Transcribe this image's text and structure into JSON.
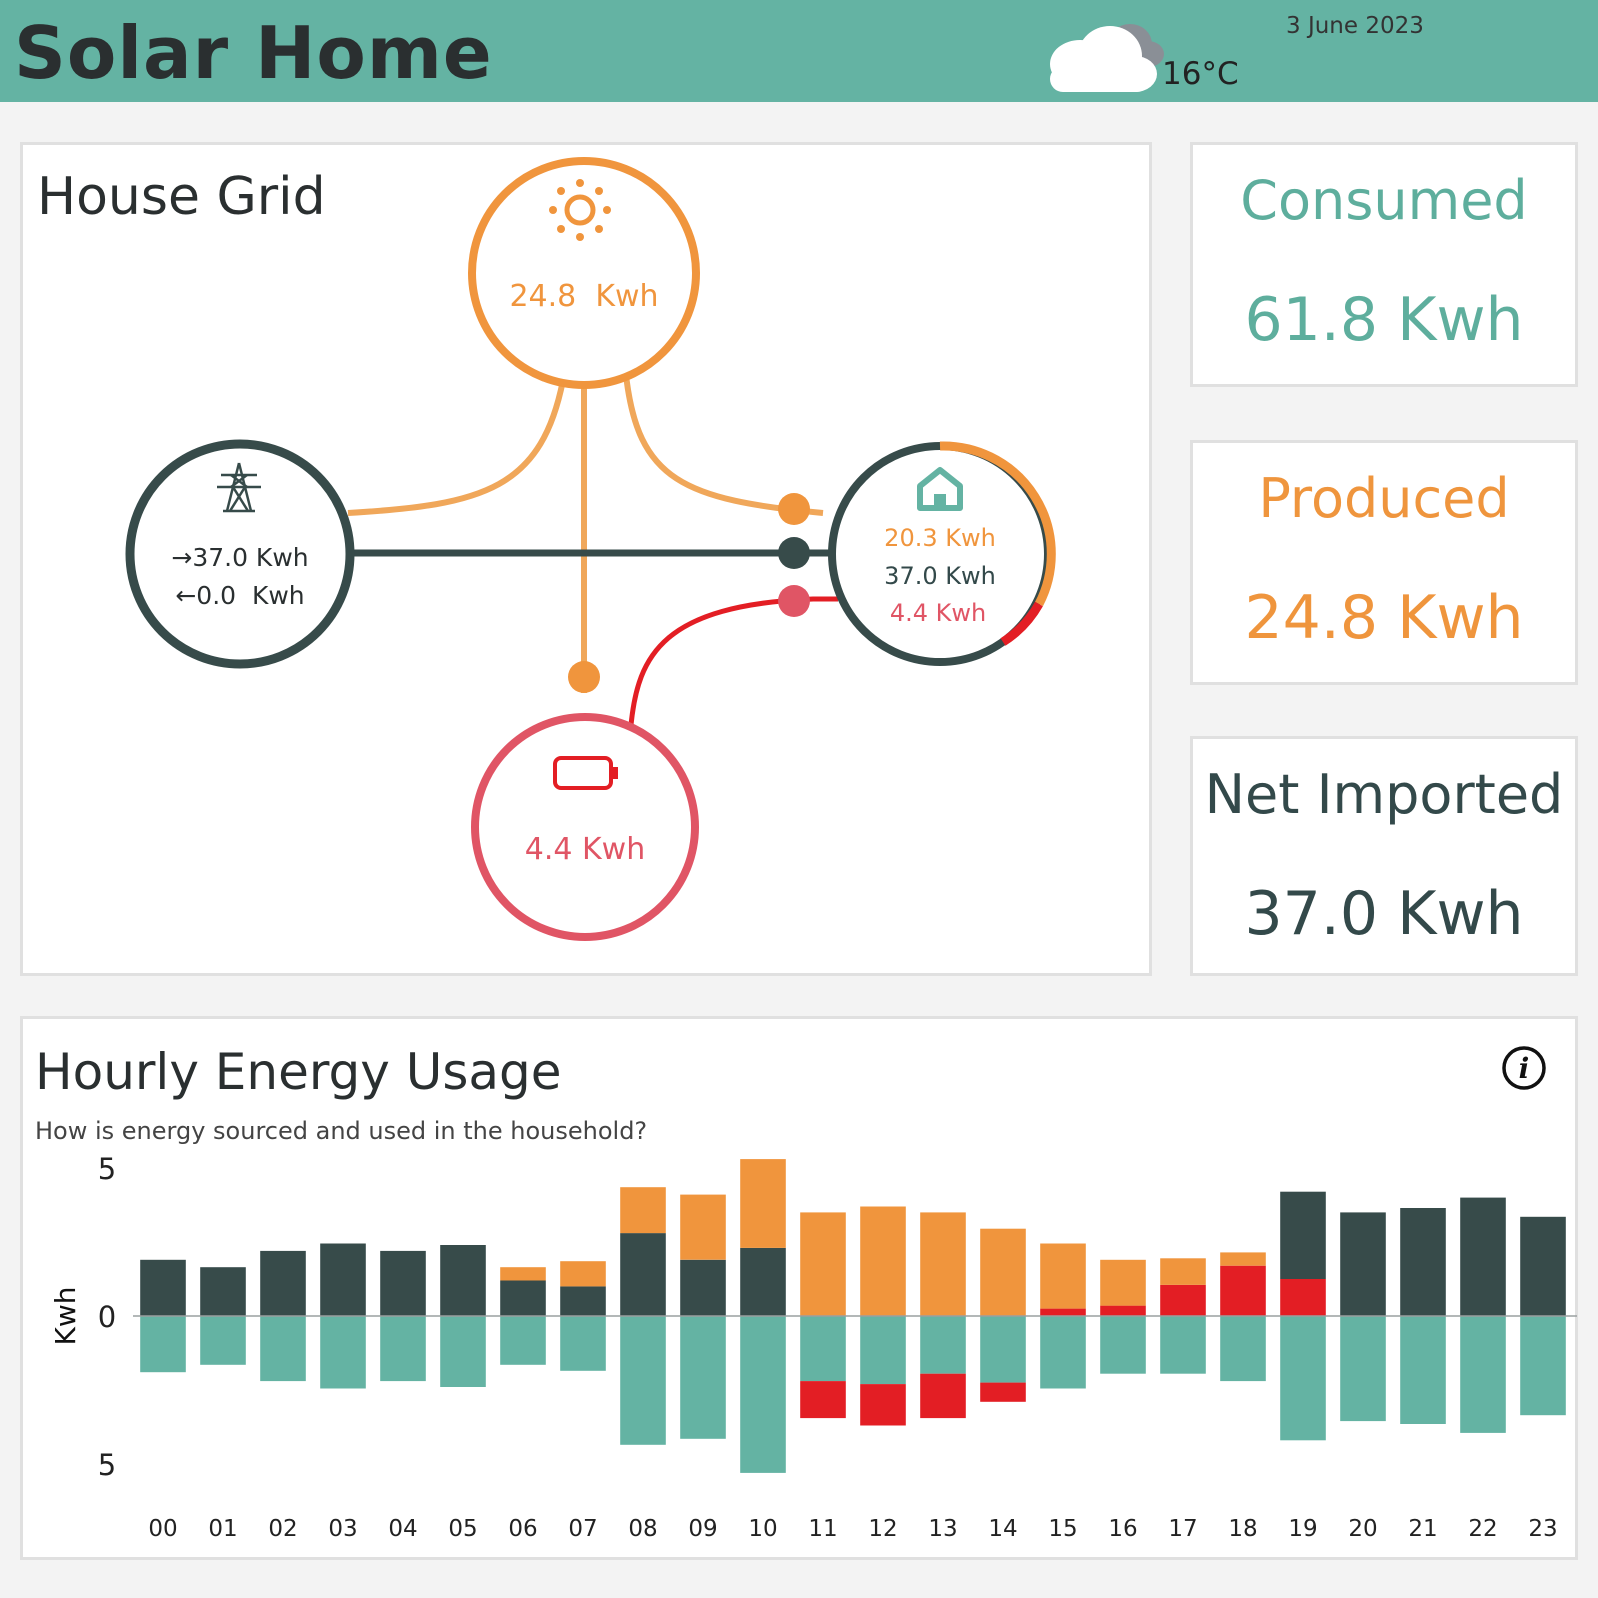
{
  "header": {
    "title": "Solar Home",
    "temperature": "16°C",
    "date": "3 June 2023",
    "weather_icon": "cloud-icon"
  },
  "house_grid": {
    "title": "House Grid",
    "solar": {
      "icon": "sun-icon",
      "value": "24.8  Kwh"
    },
    "grid": {
      "icon": "pylon-icon",
      "imported": "→37.0 Kwh",
      "exported": "←0.0  Kwh"
    },
    "battery": {
      "icon": "battery-icon",
      "value": "4.4 Kwh"
    },
    "home": {
      "icon": "house-icon",
      "from_solar": "20.3 Kwh",
      "from_grid": "37.0 Kwh",
      "from_battery": "4.4 Kwh"
    }
  },
  "kpis": {
    "consumed": {
      "label": "Consumed",
      "value": "61.8 Kwh"
    },
    "produced": {
      "label": "Produced",
      "value": "24.8 Kwh"
    },
    "net_imported": {
      "label": "Net Imported",
      "value": "37.0 Kwh"
    }
  },
  "chart": {
    "title": "Hourly Energy Usage",
    "subtitle": "How is energy sourced and used in the household?",
    "info_icon": "info-icon"
  },
  "colors": {
    "header": "#64b3a3",
    "solar": "#f0953d",
    "grid": "#374b4a",
    "battery": "#e31e24",
    "consumption": "#64b3a3",
    "battery_circle": "#e05565"
  },
  "chart_data": {
    "type": "bar",
    "categories": [
      "00",
      "01",
      "02",
      "03",
      "04",
      "05",
      "06",
      "07",
      "08",
      "09",
      "10",
      "11",
      "12",
      "13",
      "14",
      "15",
      "16",
      "17",
      "18",
      "19",
      "20",
      "21",
      "22",
      "23"
    ],
    "ylabel": "Kwh",
    "y_ticks": [
      "5",
      "0",
      "5"
    ],
    "ylim": [
      -5,
      5
    ],
    "series": [
      {
        "values": [
          1.9,
          1.65,
          2.2,
          2.45,
          2.2,
          2.4,
          1.2,
          1.0,
          2.8,
          1.9,
          2.3,
          0,
          0,
          0,
          0,
          0,
          0,
          0,
          0,
          0,
          3.5,
          3.65,
          4.0,
          3.35
        ],
        "color": "#374b4a"
      },
      {
        "values": [
          0,
          0,
          0,
          0,
          0,
          0,
          0,
          0,
          0,
          0,
          0,
          0,
          0,
          0,
          0,
          0.25,
          0.35,
          1.05,
          1.7,
          1.25,
          0,
          0,
          0,
          0
        ],
        "color": "#e31e24"
      },
      {
        "values": [
          0,
          0,
          0,
          0,
          0,
          0,
          0,
          0,
          0,
          0,
          0,
          0,
          0,
          0,
          0,
          0,
          0,
          0,
          0,
          2.95,
          0,
          0,
          0,
          0
        ],
        "color": "#374b4a"
      },
      {
        "values": [
          0,
          0,
          0,
          0,
          0,
          0,
          0.45,
          0.85,
          1.55,
          2.2,
          3.0,
          3.5,
          3.7,
          3.5,
          2.95,
          2.2,
          1.55,
          0.9,
          0.45,
          0,
          0,
          0,
          0,
          0
        ],
        "color": "#f0953d"
      },
      {
        "values": [
          -1.9,
          -1.65,
          -2.2,
          -2.45,
          -2.2,
          -2.4,
          -1.65,
          -1.85,
          -4.35,
          -4.15,
          -5.3,
          -2.2,
          -2.3,
          -1.95,
          -2.25,
          -2.45,
          -1.95,
          -1.95,
          -2.2,
          -4.2,
          -3.55,
          -3.65,
          -3.95,
          -3.35
        ],
        "color": "#64b3a3"
      },
      {
        "values": [
          0,
          0,
          0,
          0,
          0,
          0,
          0,
          0,
          0,
          0,
          0,
          -1.25,
          -1.4,
          -1.5,
          -0.65,
          0,
          0,
          0,
          0,
          0,
          0,
          0,
          0,
          0
        ],
        "color": "#e31e24"
      }
    ]
  }
}
